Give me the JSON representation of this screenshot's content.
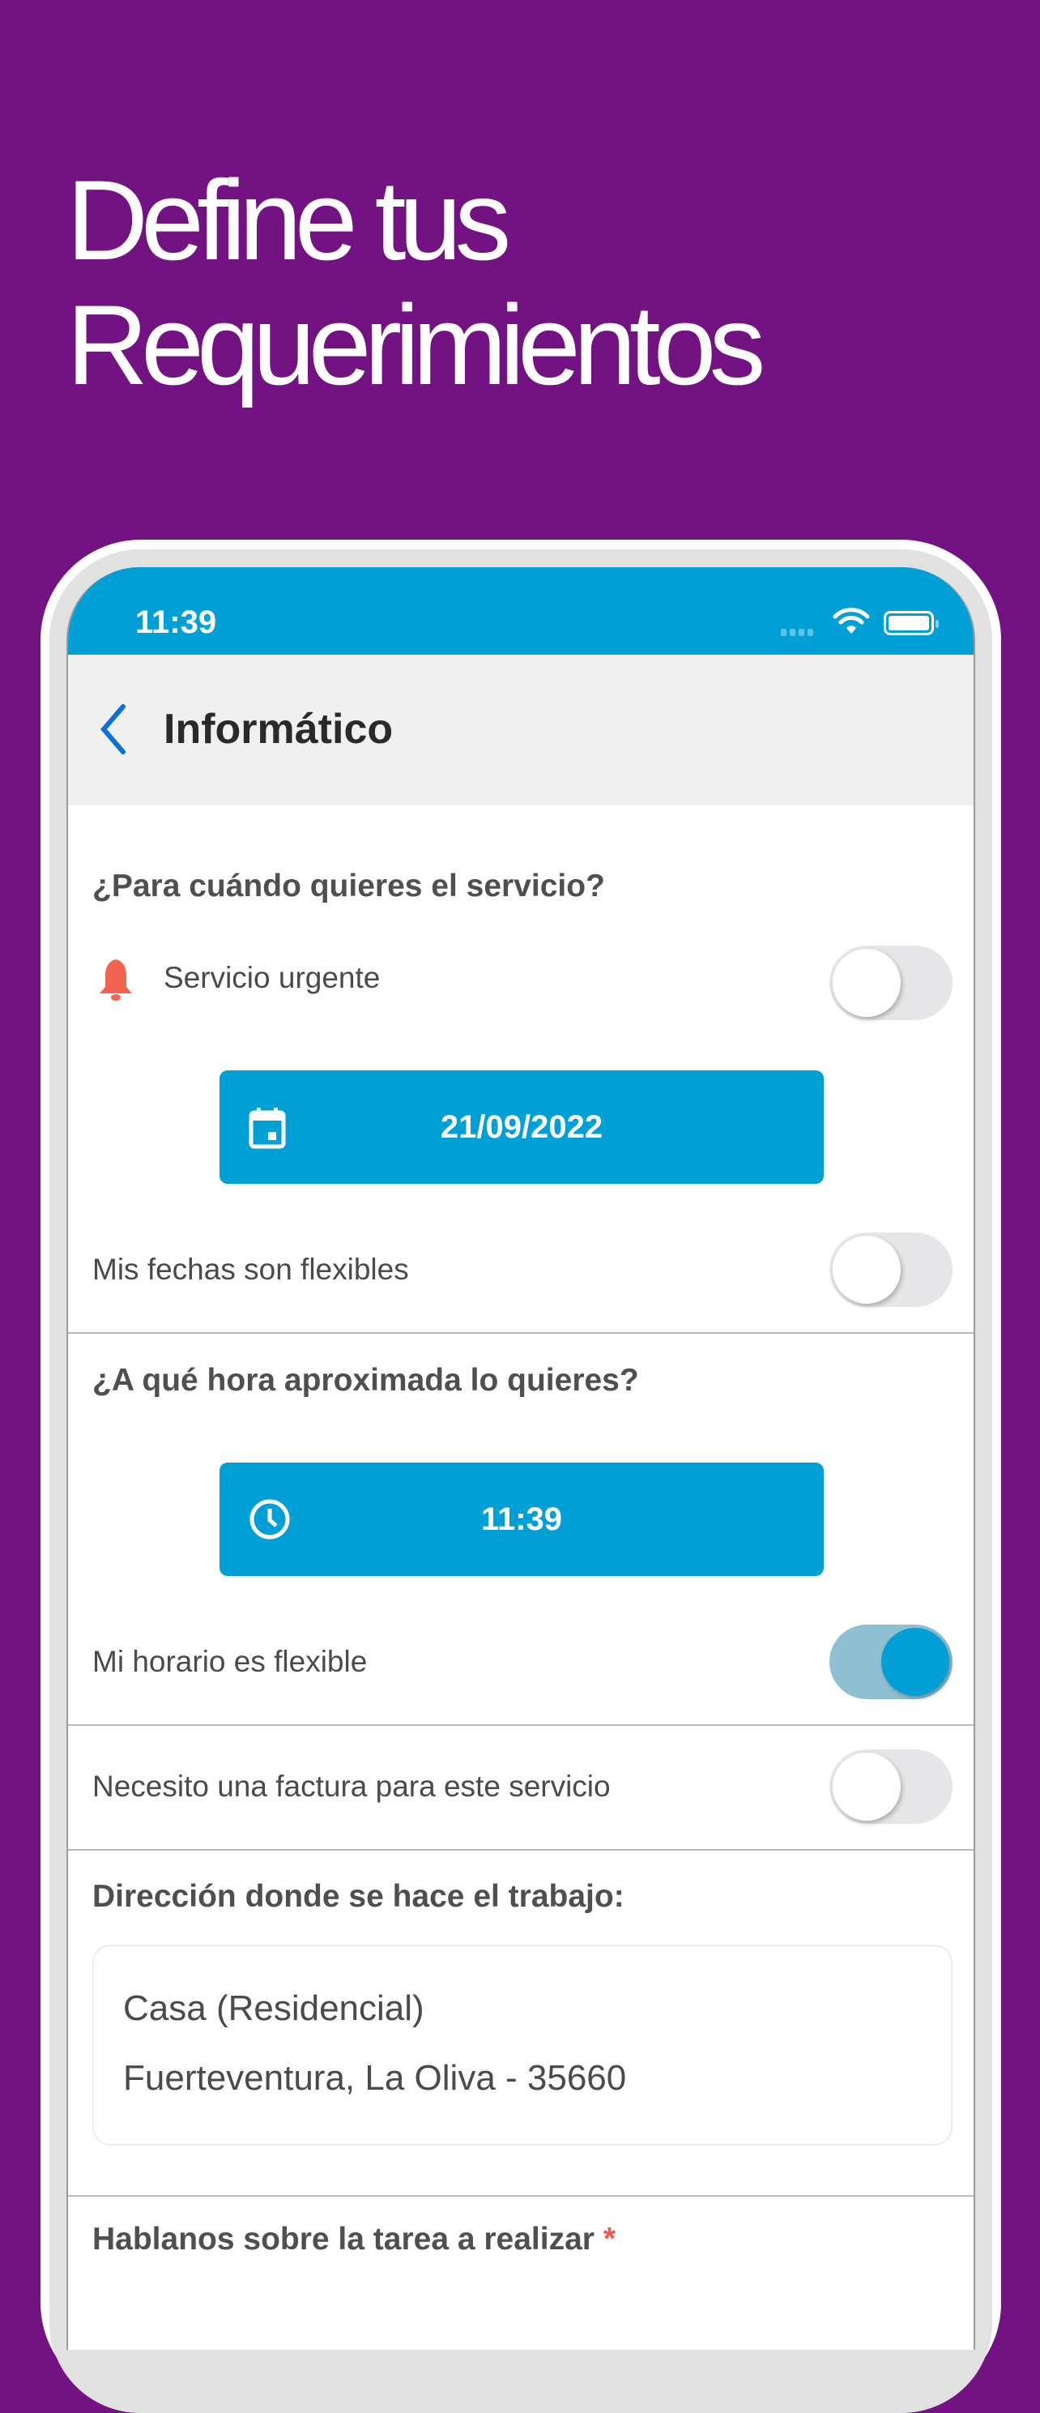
{
  "headline": {
    "line1": "Define tus",
    "line2": "Requerimientos"
  },
  "status_bar": {
    "time": "11:39",
    "icons": [
      "signal-icon",
      "wifi-icon",
      "battery-icon"
    ]
  },
  "nav": {
    "back_icon": "chevron-left-icon",
    "title": "Informático"
  },
  "when": {
    "heading": "¿Para cuándo quieres el servicio?",
    "urgent": {
      "icon": "bell-icon",
      "label": "Servicio urgente",
      "on": false
    },
    "date": {
      "icon": "calendar-icon",
      "value": "21/09/2022"
    },
    "flexible_dates": {
      "label": "Mis fechas son flexibles",
      "on": false
    }
  },
  "time": {
    "heading": "¿A qué hora aproximada lo quieres?",
    "time": {
      "icon": "clock-icon",
      "value": "11:39"
    },
    "flexible_time": {
      "label": "Mi horario es flexible",
      "on": true
    }
  },
  "invoice": {
    "label": "Necesito una factura para este servicio",
    "on": false
  },
  "address": {
    "heading": "Dirección donde se hace el trabajo:",
    "type": "Casa (Residencial)",
    "location": "Fuerteventura, La Oliva - 35660"
  },
  "task": {
    "heading": "Hablanos sobre la tarea a realizar",
    "required_mark": "*"
  },
  "colors": {
    "background": "#731282",
    "primary": "#00a0d6",
    "bell": "#f26450",
    "required": "#f05a4a"
  }
}
